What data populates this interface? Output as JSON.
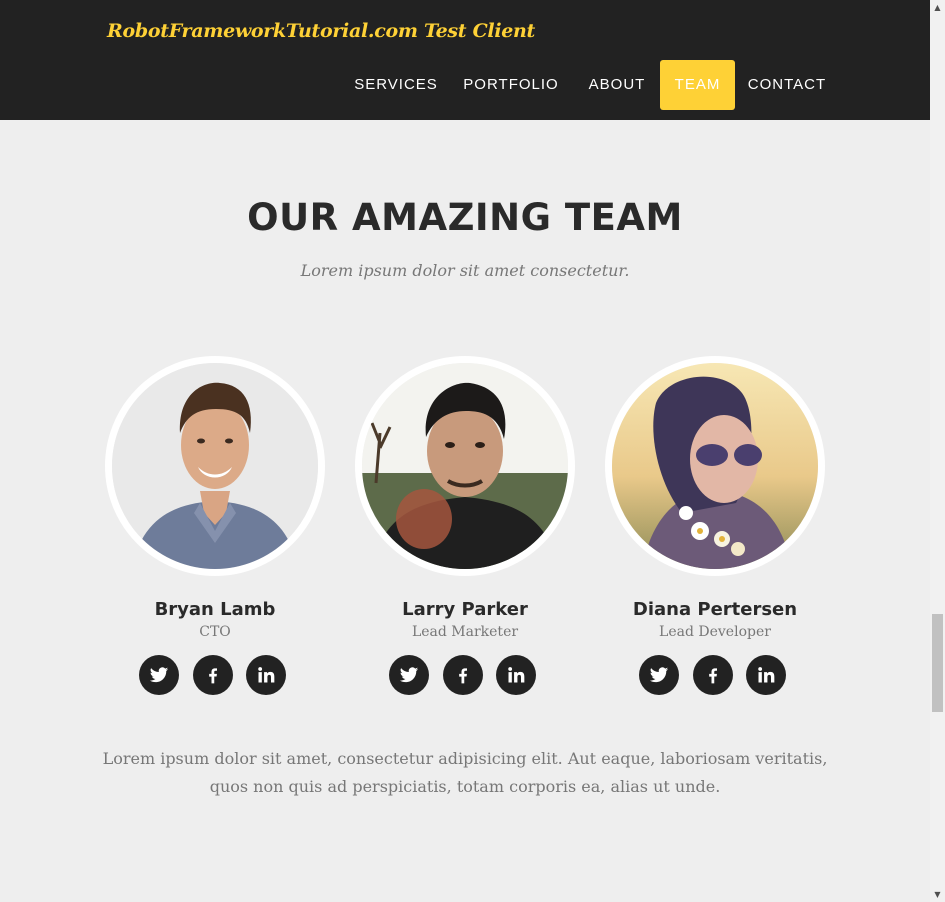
{
  "header": {
    "brand": "RobotFrameworkTutorial.com Test Client",
    "nav": [
      {
        "label": "SERVICES"
      },
      {
        "label": "PORTFOLIO"
      },
      {
        "label": "ABOUT"
      },
      {
        "label": "TEAM",
        "active": true
      },
      {
        "label": "CONTACT"
      }
    ]
  },
  "team": {
    "title": "OUR AMAZING TEAM",
    "subtitle": "Lorem ipsum dolor sit amet consectetur.",
    "members": [
      {
        "name": "Bryan Lamb",
        "role": "CTO",
        "social": [
          "twitter-icon",
          "facebook-icon",
          "linkedin-icon"
        ]
      },
      {
        "name": "Larry Parker",
        "role": "Lead Marketer",
        "social": [
          "twitter-icon",
          "facebook-icon",
          "linkedin-icon"
        ]
      },
      {
        "name": "Diana Pertersen",
        "role": "Lead Developer",
        "social": [
          "twitter-icon",
          "facebook-icon",
          "linkedin-icon"
        ]
      }
    ],
    "description": "Lorem ipsum dolor sit amet, consectetur adipisicing elit. Aut eaque, laboriosam veritatis, quos non quis ad perspiciatis, totam corporis ea, alias ut unde."
  },
  "colors": {
    "accent": "#fed136",
    "navbar_bg": "#222222",
    "page_bg": "#eeeeee",
    "heading": "#2a2a2a",
    "muted": "#777777"
  }
}
